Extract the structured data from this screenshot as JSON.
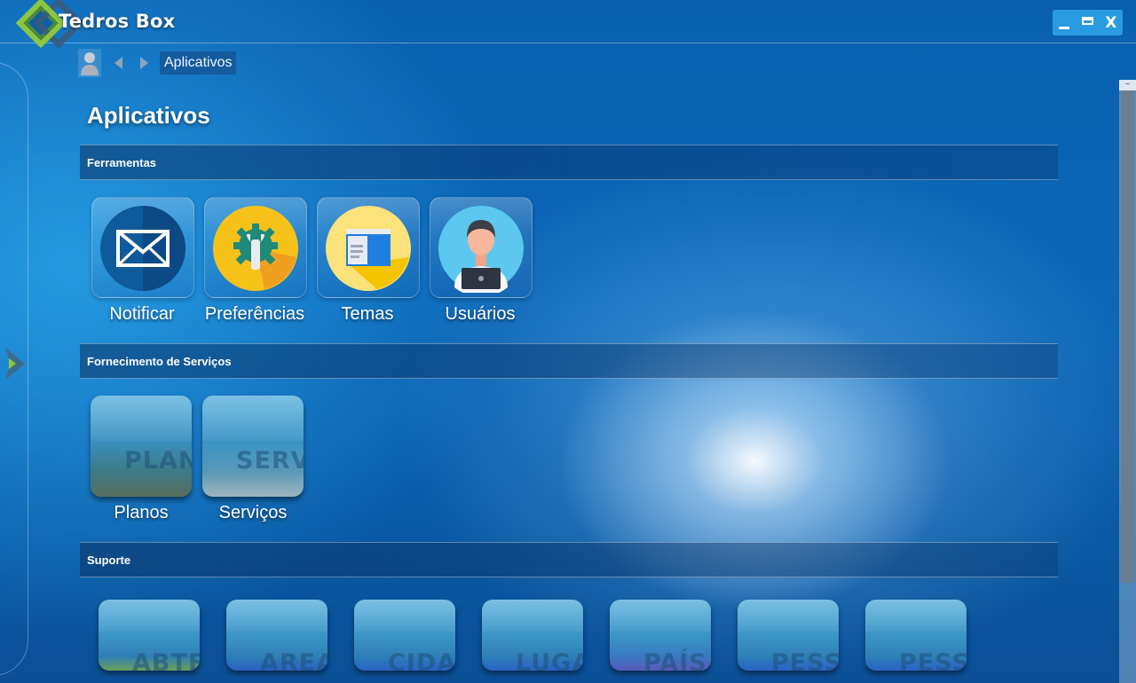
{
  "app": {
    "title": "Tedros Box"
  },
  "window_controls": {
    "minimize": "_",
    "maximize": "▭",
    "close": "X"
  },
  "nav": {
    "breadcrumb": "Aplicativos",
    "icons": [
      "user-icon",
      "arrow-left-icon",
      "arrow-right-icon"
    ]
  },
  "page": {
    "title": "Aplicativos"
  },
  "sections": [
    {
      "title": "Ferramentas",
      "items": [
        {
          "label": "Notificar",
          "icon": "envelope-icon"
        },
        {
          "label": "Preferências",
          "icon": "gear-wrench-icon"
        },
        {
          "label": "Temas",
          "icon": "theme-window-icon"
        },
        {
          "label": "Usuários",
          "icon": "user-avatar-icon"
        }
      ]
    },
    {
      "title": "Fornecimento de Serviços",
      "items": [
        {
          "label": "Planos",
          "watermark": "PLAN"
        },
        {
          "label": "Serviços",
          "watermark": "SERV"
        }
      ]
    },
    {
      "title": "Suporte",
      "items": [
        {
          "watermark": "ABTE"
        },
        {
          "watermark": "AREA"
        },
        {
          "watermark": "CIDA"
        },
        {
          "watermark": "LUGA"
        },
        {
          "watermark": "PAÍS"
        },
        {
          "watermark": "PESS"
        },
        {
          "watermark": "PESS"
        }
      ]
    }
  ],
  "colors": {
    "accent": "#2a9be0",
    "background": "#0b66b8",
    "section_bar": "#0a3264"
  }
}
